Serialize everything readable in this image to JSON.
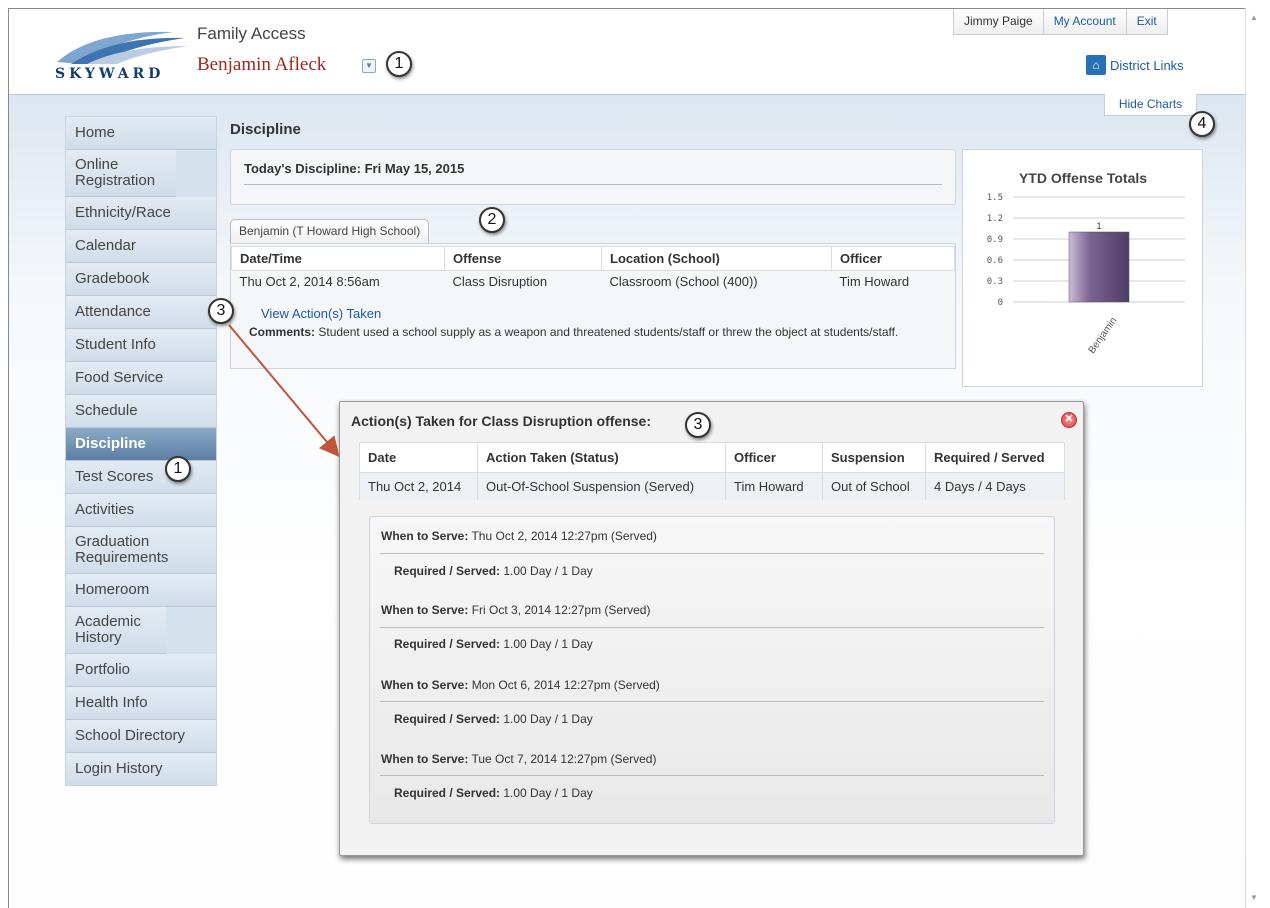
{
  "header": {
    "app_title": "Family Access",
    "student_name": "Benjamin Afleck",
    "logo_text": "SKYWARD",
    "user_name": "Jimmy Paige",
    "my_account": "My Account",
    "exit": "Exit",
    "district_links": "District Links",
    "hide_charts": "Hide Charts"
  },
  "callouts": [
    "1",
    "2",
    "3",
    "4"
  ],
  "sidebar": {
    "items": [
      {
        "label": "Home"
      },
      {
        "label": "Online Registration"
      },
      {
        "label": "Ethnicity/Race"
      },
      {
        "label": "Calendar"
      },
      {
        "label": "Gradebook"
      },
      {
        "label": "Attendance"
      },
      {
        "label": "Student Info"
      },
      {
        "label": "Food Service"
      },
      {
        "label": "Schedule"
      },
      {
        "label": "Discipline"
      },
      {
        "label": "Test Scores"
      },
      {
        "label": "Activities"
      },
      {
        "label": "Graduation Requirements"
      },
      {
        "label": "Homeroom"
      },
      {
        "label": "Academic History"
      },
      {
        "label": "Portfolio"
      },
      {
        "label": "Health Info"
      },
      {
        "label": "School Directory"
      },
      {
        "label": "Login History"
      }
    ],
    "active": "Discipline"
  },
  "main": {
    "page_title": "Discipline",
    "today": "Today's Discipline: Fri May 15, 2015",
    "school_tab": "Benjamin (T Howard High School)",
    "table": {
      "headers": [
        "Date/Time",
        "Offense",
        "Location (School)",
        "Officer"
      ],
      "row": [
        "Thu Oct 2, 2014 8:56am",
        "Class Disruption",
        "Classroom (School (400))",
        "Tim Howard"
      ]
    },
    "view_actions": "View Action(s) Taken",
    "comments_label": "Comments:",
    "comments_text": " Student used a school supply as a weapon and threatened students/staff or threw the object at students/staff."
  },
  "chart_data": {
    "type": "bar",
    "title": "YTD Offense Totals",
    "categories": [
      "Benjamin"
    ],
    "values": [
      1
    ],
    "data_labels": [
      "1"
    ],
    "ylim": [
      0,
      1.5
    ],
    "yticks": [
      "0",
      "0.3",
      "0.6",
      "0.9",
      "1.2",
      "1.5"
    ],
    "bar_color": "#7a6391",
    "grid": true
  },
  "modal": {
    "title": "Action(s) Taken for Class Disruption offense:",
    "close_icon": "close-icon",
    "headers": [
      "Date",
      "Action Taken (Status)",
      "Officer",
      "Suspension",
      "Required / Served"
    ],
    "row": [
      "Thu Oct 2, 2014",
      "Out-Of-School Suspension (Served)",
      "Tim Howard",
      "Out of School",
      "4 Days / 4 Days"
    ],
    "when_label": "When to Serve:",
    "req_label": "Required / Served:",
    "serve_entries": [
      {
        "when": " Thu Oct 2, 2014 12:27pm (Served)",
        "req": " 1.00 Day / 1 Day"
      },
      {
        "when": " Fri Oct 3, 2014 12:27pm (Served)",
        "req": " 1.00 Day / 1 Day"
      },
      {
        "when": " Mon Oct 6, 2014 12:27pm (Served)",
        "req": " 1.00 Day / 1 Day"
      },
      {
        "when": " Tue Oct 7, 2014 12:27pm (Served)",
        "req": " 1.00 Day / 1 Day"
      }
    ]
  },
  "colors": {
    "brand_blue": "#123c72",
    "link": "#1e5aa6",
    "student_name": "#a0281c",
    "annotation_arrow": "#c0553b"
  }
}
